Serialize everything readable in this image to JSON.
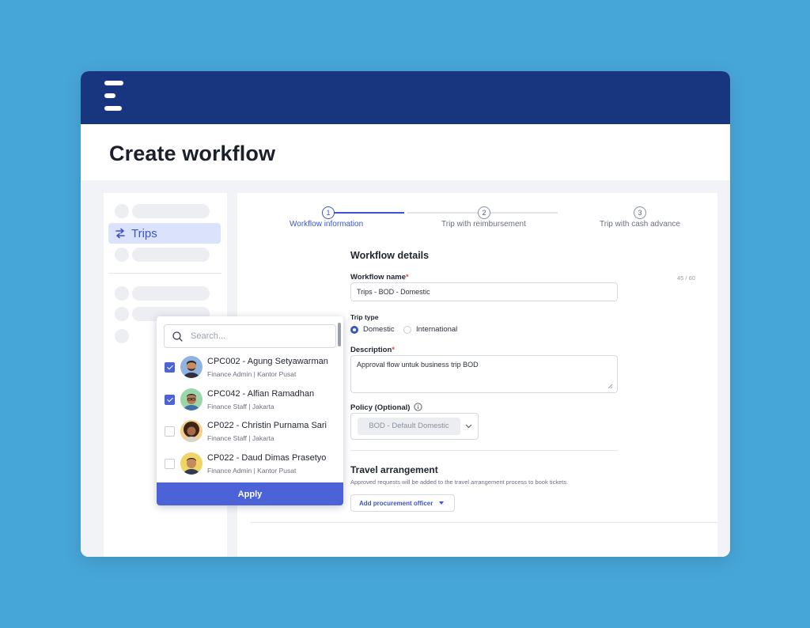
{
  "header": {
    "logo_icon": "menu-logo-icon",
    "brand_color": "#183680"
  },
  "page": {
    "title": "Create workflow"
  },
  "sidebar": {
    "active_item": {
      "label": "Trips",
      "icon": "swap-arrows-icon"
    }
  },
  "stepper": {
    "steps": [
      {
        "number": "1",
        "label": "Workflow information",
        "active": true
      },
      {
        "number": "2",
        "label": "Trip with reimbursement",
        "active": false
      },
      {
        "number": "3",
        "label": "Trip with cash advance",
        "active": false
      }
    ]
  },
  "form": {
    "section_title": "Workflow details",
    "workflow_name": {
      "label": "Workflow name",
      "required_mark": "*",
      "value": "Trips - BOD - Domestic",
      "counter": "45 / 60"
    },
    "trip_type": {
      "label": "Trip type",
      "options": [
        "Domestic",
        "International"
      ],
      "selected": "Domestic"
    },
    "description": {
      "label": "Description",
      "required_mark": "*",
      "value": "Approval flow untuk business trip BOD"
    },
    "policy": {
      "label": "Policy (Optional)",
      "info_icon": "info-icon",
      "value": "BOD - Default Domestic"
    }
  },
  "travel": {
    "title": "Travel arrangement",
    "description": "Approved requests will be added to the travel arrangement process to book tickets.",
    "button_label": "Add procurement officer"
  },
  "dropdown": {
    "search_placeholder": "Search...",
    "people": [
      {
        "name": "CPC002 - Agung Setyawarman",
        "role": "Finance Admin",
        "location": "Kantor Pusat",
        "checked": true
      },
      {
        "name": "CPC042 - Alfian Ramadhan",
        "role": "Finance Staff",
        "location": "Jakarta",
        "checked": true
      },
      {
        "name": "CP022 - Christin Purnama Sari",
        "role": "Finance Staff",
        "location": "Jakarta",
        "checked": false
      },
      {
        "name": "CP022 - Daud Dimas Prasetyo",
        "role": "Finance Admin",
        "location": "Kantor Pusat",
        "checked": false
      }
    ],
    "apply_label": "Apply"
  },
  "colors": {
    "accent": "#4c63d8",
    "background": "#47a6d8",
    "required": "#e5484d"
  }
}
